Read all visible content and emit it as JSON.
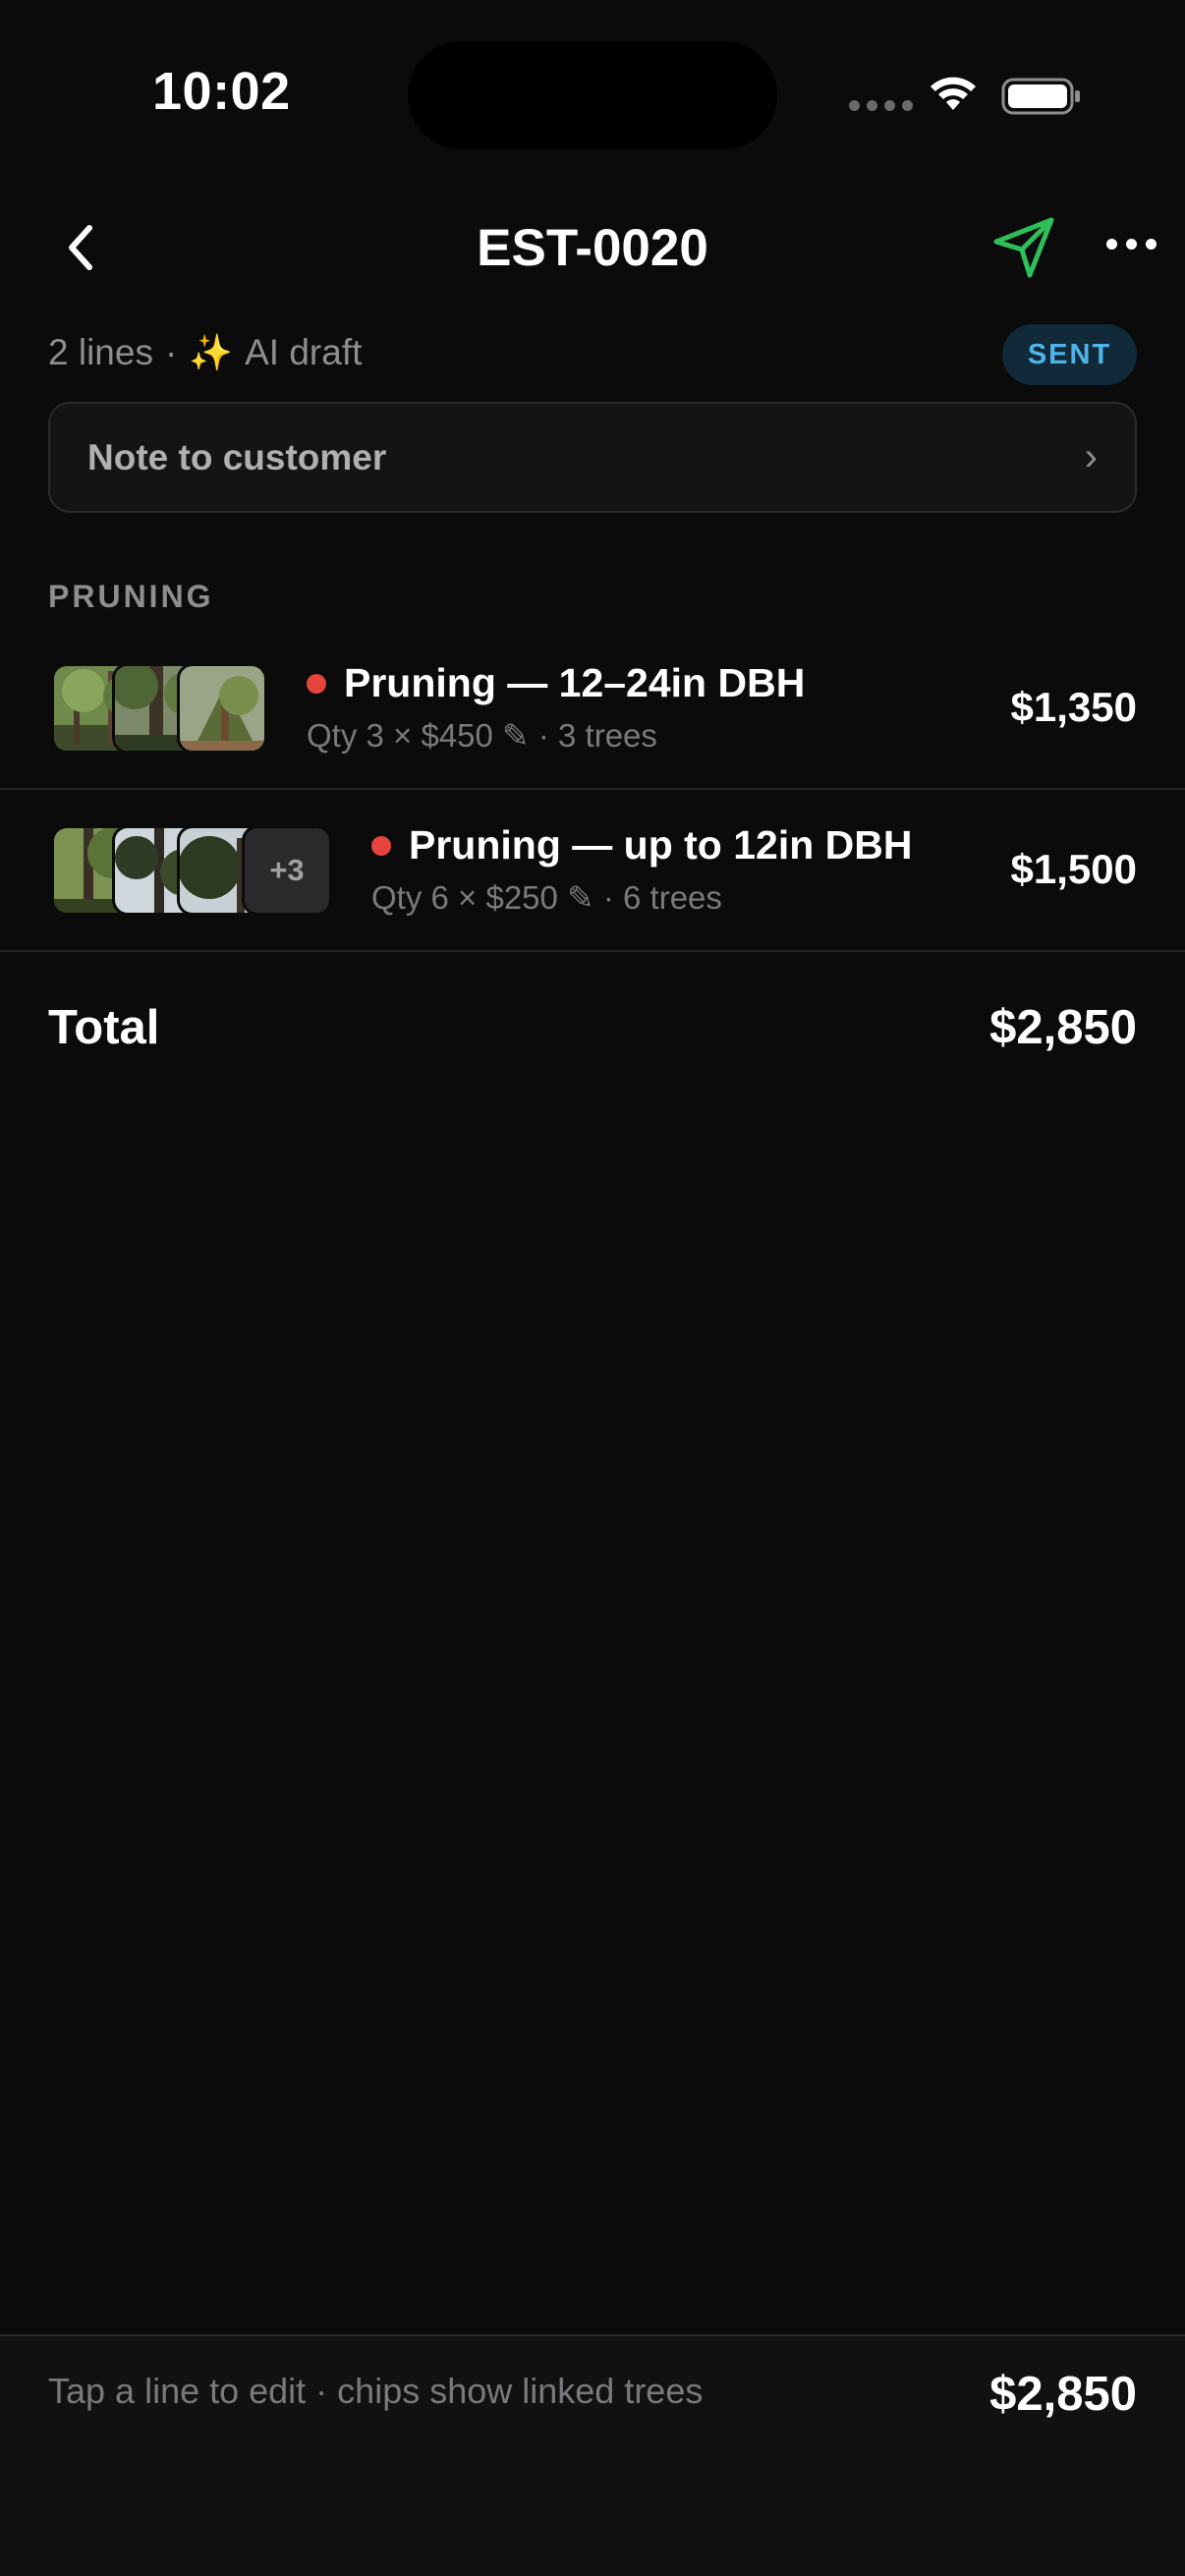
{
  "status_bar": {
    "time": "10:02"
  },
  "header": {
    "title": "EST-0020"
  },
  "meta": {
    "lines": "2 lines",
    "separator": "·",
    "sparkle": "✨",
    "ai_label": "AI draft",
    "status": "SENT"
  },
  "note": {
    "label": "Note to customer",
    "chevron": "›"
  },
  "section": {
    "title": "PRUNING"
  },
  "lines": [
    {
      "title": "Pruning — 12–24in DBH",
      "subtitle": "Qty 3 × $450 ✎ · 3 trees",
      "price": "$1,350"
    },
    {
      "title": "Pruning — up to 12in DBH",
      "subtitle": "Qty 6 × $250 ✎ · 6 trees",
      "price": "$1,500",
      "more_chip": "+3"
    }
  ],
  "total": {
    "label": "Total",
    "value": "$2,850"
  },
  "footer": {
    "hint": "Tap a line to edit · chips show linked trees",
    "total": "$2,850"
  },
  "colors": {
    "accent_green": "#2fbf5a",
    "badge_text": "#4fb3ea",
    "badge_bg": "#102a3a",
    "dot_red": "#e5453d"
  }
}
